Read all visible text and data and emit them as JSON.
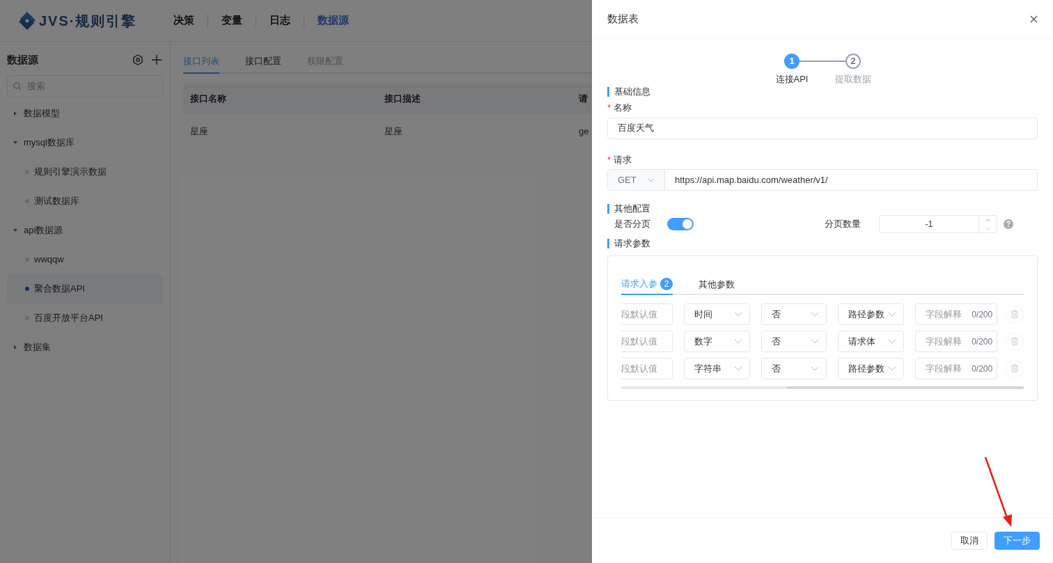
{
  "header": {
    "logo_text": "JVS·规则引擎",
    "nav": [
      {
        "label": "决策",
        "selected": false
      },
      {
        "label": "变量",
        "selected": false
      },
      {
        "label": "日志",
        "selected": false
      },
      {
        "label": "数据源",
        "selected": true
      }
    ]
  },
  "sidebar": {
    "title": "数据源",
    "search": {
      "placeholder": "搜索"
    },
    "tree": [
      {
        "label": "数据模型",
        "expanded": false
      },
      {
        "label": "mysql数据库",
        "expanded": true,
        "children": [
          {
            "label": "规则引擎演示数据",
            "selected": false
          },
          {
            "label": "测试数据库",
            "selected": false
          }
        ]
      },
      {
        "label": "api数据源",
        "expanded": true,
        "children": [
          {
            "label": "wwqqw",
            "selected": false
          },
          {
            "label": "聚合数据API",
            "selected": true
          },
          {
            "label": "百度开放平台API",
            "selected": false
          }
        ]
      },
      {
        "label": "数据集",
        "expanded": false
      }
    ]
  },
  "main": {
    "tabs": [
      {
        "label": "接口列表",
        "selected": true,
        "disabled": false
      },
      {
        "label": "接口配置",
        "selected": false,
        "disabled": false
      },
      {
        "label": "权限配置",
        "selected": false,
        "disabled": true
      }
    ],
    "table": {
      "columns": [
        "接口名称",
        "接口描述",
        "请"
      ],
      "rows": [
        [
          "星座",
          "星座",
          "ge"
        ]
      ]
    }
  },
  "drawer": {
    "title": "数据表",
    "steps": [
      {
        "num": "1",
        "label": "连接API",
        "active": true
      },
      {
        "num": "2",
        "label": "提取数据",
        "active": false
      }
    ],
    "basic_section": "基础信息",
    "name_mark": "*",
    "name_label": "名称",
    "name_value": "百度天气",
    "request_mark": "*",
    "request_label": "请求",
    "method": "GET",
    "url": "https://api.map.baidu.com/weather/v1/",
    "other_section": "其他配置",
    "paging_label": "是否分页",
    "paging_on": true,
    "page_size_label": "分页数量",
    "page_size": "-1",
    "params_section": "请求参数",
    "param_tabs": [
      {
        "label": "请求入参",
        "badge": "2",
        "selected": true
      },
      {
        "label": "其他参数",
        "selected": false
      }
    ],
    "params": [
      {
        "default_placeholder": "段默认值",
        "type": "时间",
        "required": "否",
        "position": "路径参数",
        "desc_placeholder": "字段解释",
        "count": "0/200"
      },
      {
        "default_placeholder": "段默认值",
        "type": "数字",
        "required": "否",
        "position": "请求体",
        "desc_placeholder": "字段解释",
        "count": "0/200"
      },
      {
        "default_placeholder": "段默认值",
        "type": "字符串",
        "required": "否",
        "position": "路径参数",
        "desc_placeholder": "字段解释",
        "count": "0/200"
      }
    ],
    "buttons": [
      {
        "label": "取消",
        "kind": "default"
      },
      {
        "label": "下一步",
        "kind": "primary"
      }
    ]
  }
}
